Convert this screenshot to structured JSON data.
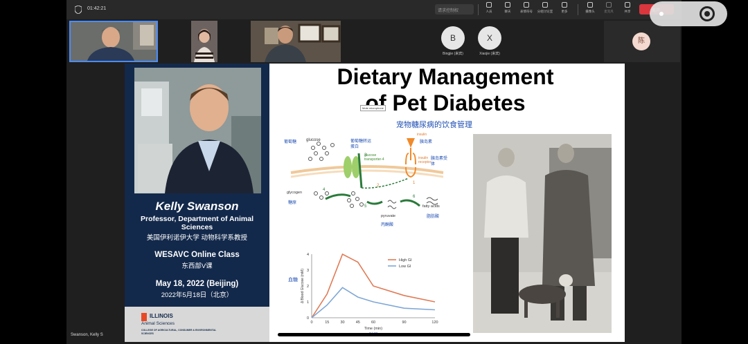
{
  "topbar": {
    "timer": "01:42:21",
    "search_placeholder": "请求控制权",
    "buttons": [
      {
        "icon": "people-icon",
        "label": "人员"
      },
      {
        "icon": "chat-icon",
        "label": "聊天"
      },
      {
        "icon": "raise-hand-icon",
        "label": "表情符号"
      },
      {
        "icon": "rooms-icon",
        "label": "分组讨论室"
      },
      {
        "icon": "more-icon",
        "label": "更多"
      },
      {
        "icon": "camera-icon",
        "label": "摄像头"
      },
      {
        "icon": "mic-icon",
        "label": "麦克风"
      },
      {
        "icon": "share-icon",
        "label": "共享"
      }
    ],
    "leave_label": "离开",
    "colors": {
      "leave": "#d9363e",
      "active_border": "#4a8cff"
    }
  },
  "participants": {
    "avatars": [
      {
        "initial": "B",
        "name": "Bingjie (来宾)"
      },
      {
        "initial": "X",
        "name": "Xiaojie (来宾)"
      }
    ],
    "chen_initial": "陈",
    "self_label": "Swanson, Kelly S"
  },
  "slide": {
    "tooltip": "Mute microphone",
    "title_line1": "Dietary Management",
    "title_line2": "of Pet Diabetes",
    "subtitle_zh": "宠物糖尿病的饮食管理",
    "speaker": {
      "name": "Kelly Swanson",
      "title": "Professor, Department of Animal Sciences",
      "title_zh": "美国伊利诺伊大学 动物科学系教授",
      "class": "WESAVC Online Class",
      "class_zh": "东西部V课",
      "date": "May 18, 2022 (Beijing)",
      "date_zh": "2022年5月18日（北京）"
    },
    "footer": {
      "university": "ILLINOIS",
      "dept": "Animal Sciences",
      "college": "COLLEGE OF AGRICULTURAL, CONSUMER & ENVIRONMENTAL SCIENCES"
    },
    "diagram": {
      "glucose_zh": "葡萄糖",
      "glucose": "glucose",
      "transporter_zh": "葡萄糖转运蛋白",
      "transporter": "glucose transporter-4",
      "insulin": "insulin",
      "insulin_zh": "胰岛素",
      "receptor": "insulin receptor",
      "receptor_zh": "胰岛素受体",
      "glycogen": "glycogen",
      "glycogen_zh": "糖原",
      "pyruvate": "pyruvate",
      "pyruvate_zh": "丙酮酸",
      "fatty_acids": "fatty acids",
      "fatty_acids_zh": "脂肪酸",
      "steps": [
        "1",
        "2",
        "3",
        "4",
        "5",
        "6"
      ]
    },
    "chart_ylabel_zh": "血糖",
    "chart_xlabel_zh": "时间"
  },
  "chart_data": {
    "type": "line",
    "title": "",
    "xlabel": "Time (min)",
    "ylabel": "Δ Blood Glucose (mM)",
    "x": [
      0,
      15,
      30,
      45,
      60,
      90,
      120
    ],
    "xticks": [
      "0",
      "15",
      "30",
      "45",
      "60",
      "90",
      "120"
    ],
    "yticks": [
      "0",
      "1",
      "2",
      "3",
      "4"
    ],
    "ylim": [
      0,
      4
    ],
    "grid": false,
    "legend": "top-right",
    "series": [
      {
        "name": "High GI",
        "color": "#e07a55",
        "values": [
          0,
          1.5,
          4.0,
          3.5,
          2.0,
          1.4,
          1.0
        ]
      },
      {
        "name": "Low GI",
        "color": "#7fa7d6",
        "values": [
          0,
          0.8,
          1.9,
          1.3,
          1.0,
          0.6,
          0.5
        ]
      }
    ]
  }
}
